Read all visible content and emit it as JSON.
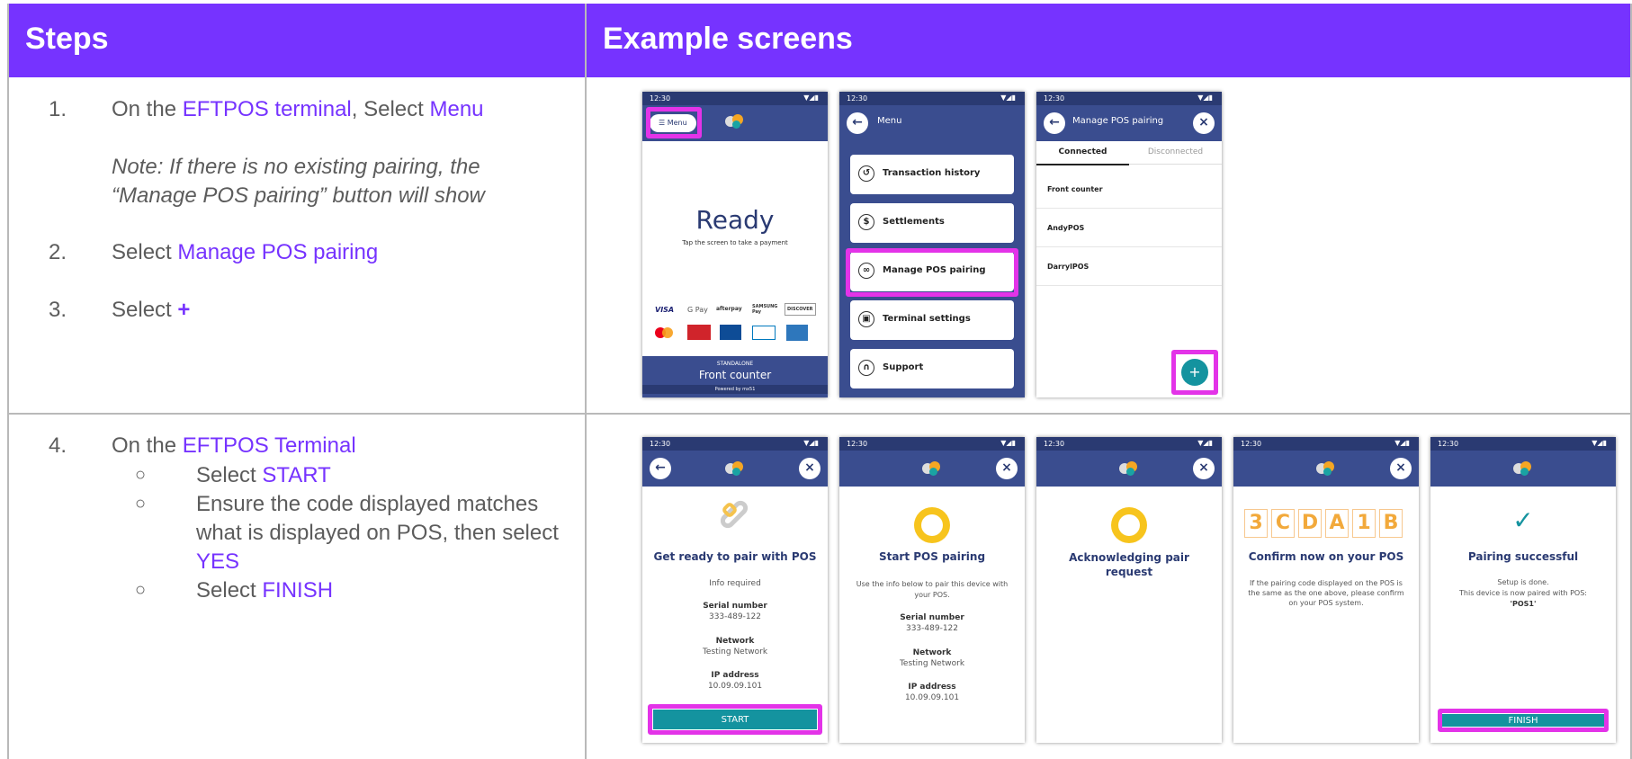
{
  "header": {
    "steps": "Steps",
    "examples": "Example screens"
  },
  "row1": {
    "s1": {
      "num": "1.",
      "pre": "On the ",
      "link1": "EFTPOS terminal",
      "mid": ", Select ",
      "link2": "Menu"
    },
    "note": "Note: If there is no existing pairing, the “Manage POS pairing” button will show",
    "s2": {
      "num": "2.",
      "pre": "Select ",
      "link": "Manage POS pairing"
    },
    "s3": {
      "num": "3.",
      "pre": "Select ",
      "plus": "+"
    }
  },
  "row2": {
    "s4": {
      "num": "4.",
      "pre": "On the ",
      "link": "EFTPOS Terminal"
    },
    "bullet": "○",
    "b1": {
      "pre": "Select ",
      "link": "START"
    },
    "b2": {
      "pre": "Ensure the code displayed matches what is displayed on POS, then select ",
      "link": "YES"
    },
    "b3": {
      "pre": "Select ",
      "link": "FINISH"
    }
  },
  "phone": {
    "time": "12:30",
    "signal": "▼◢▮"
  },
  "screen1": {
    "menu": "Menu",
    "ready": "Ready",
    "tap": "Tap the screen to take a payment",
    "standalone": "STANDALONE",
    "device": "Front counter",
    "powered": "Powered by mx51"
  },
  "screen2": {
    "title": "Menu",
    "items": [
      "Transaction history",
      "Settlements",
      "Manage POS pairing",
      "Terminal settings",
      "Support"
    ]
  },
  "screen3": {
    "title": "Manage POS pairing",
    "tab_connected": "Connected",
    "tab_disconnected": "Disconnected",
    "items": [
      "Front counter",
      "AndyPOS",
      "DarrylPOS"
    ],
    "plus": "+"
  },
  "screen4": {
    "title": "Get ready to pair with POS",
    "info": "Info required",
    "serial_label": "Serial number",
    "serial": "333-489-122",
    "network_label": "Network",
    "network": "Testing Network",
    "ip_label": "IP address",
    "ip": "10.09.09.101",
    "button": "START"
  },
  "screen5": {
    "title": "Start POS pairing",
    "desc": "Use the info below to pair this device with your POS.",
    "serial_label": "Serial number",
    "serial": "333-489-122",
    "network_label": "Network",
    "network": "Testing Network",
    "ip_label": "IP address",
    "ip": "10.09.09.101"
  },
  "screen6": {
    "title": "Acknowledging pair request"
  },
  "screen7": {
    "code": [
      "3",
      "C",
      "D",
      "A",
      "1",
      "B"
    ],
    "title": "Confirm now on your POS",
    "desc": "If the pairing code displayed on the POS is the same as the one above, please confirm on your POS system."
  },
  "screen8": {
    "check": "✓",
    "title": "Pairing successful",
    "desc1": "Setup is done.",
    "desc2": "This device is now paired with POS:",
    "pos": "'POS1'",
    "button": "FINISH"
  },
  "colors": {
    "header": "#7633ff",
    "nav": "#3a4d8f",
    "teal": "#14939f",
    "highlight": "#e333e8"
  }
}
